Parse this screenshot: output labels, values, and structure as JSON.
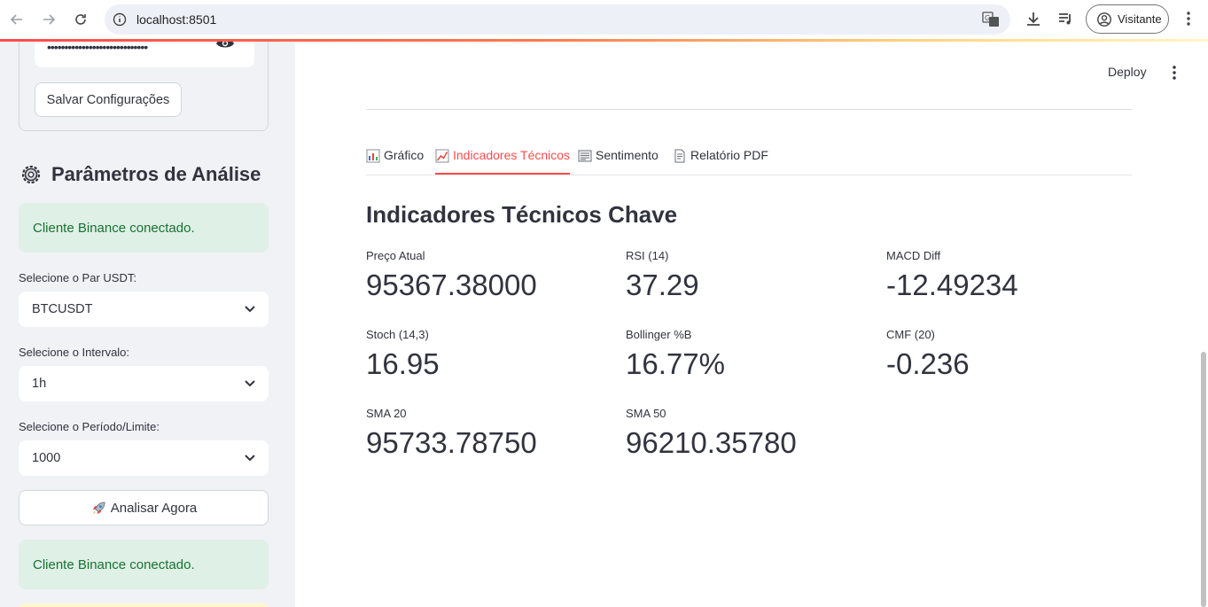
{
  "browser": {
    "url": "localhost:8501",
    "profile_label": "Visitante"
  },
  "sidebar": {
    "password_mask": "•••••••••••••••••••••••••••••",
    "save_button_label": "Salvar Configurações",
    "section_title": "Parâmetros de Análise",
    "status_message_top": "Cliente Binance conectado.",
    "pair_label": "Selecione o Par USDT:",
    "pair_value": "BTCUSDT",
    "interval_label": "Selecione o Intervalo:",
    "interval_value": "1h",
    "period_label": "Selecione o Período/Limite:",
    "period_value": "1000",
    "analyze_button_label": "Analisar Agora",
    "status_message_bottom": "Cliente Binance conectado."
  },
  "header": {
    "deploy_label": "Deploy"
  },
  "tabs": [
    {
      "label": "Gráfico",
      "icon": "bar-chart-icon",
      "active": false
    },
    {
      "label": "Indicadores Técnicos",
      "icon": "trend-chart-icon",
      "active": true
    },
    {
      "label": "Sentimento",
      "icon": "newspaper-icon",
      "active": false
    },
    {
      "label": "Relatório PDF",
      "icon": "document-icon",
      "active": false
    }
  ],
  "main": {
    "heading": "Indicadores Técnicos Chave",
    "metrics": [
      {
        "label": "Preço Atual",
        "value": "95367.38000"
      },
      {
        "label": "RSI (14)",
        "value": "37.29"
      },
      {
        "label": "MACD Diff",
        "value": "-12.49234"
      },
      {
        "label": "Stoch (14,3)",
        "value": "16.95"
      },
      {
        "label": "Bollinger %B",
        "value": "16.77%"
      },
      {
        "label": "CMF (20)",
        "value": "-0.236"
      },
      {
        "label": "SMA 20",
        "value": "95733.78750"
      },
      {
        "label": "SMA 50",
        "value": "96210.35780"
      }
    ]
  },
  "colors": {
    "accent": "#ff4b4b",
    "success_bg": "#dff0e6",
    "success_text": "#177233",
    "sidebar_bg": "#f0f2f6"
  }
}
